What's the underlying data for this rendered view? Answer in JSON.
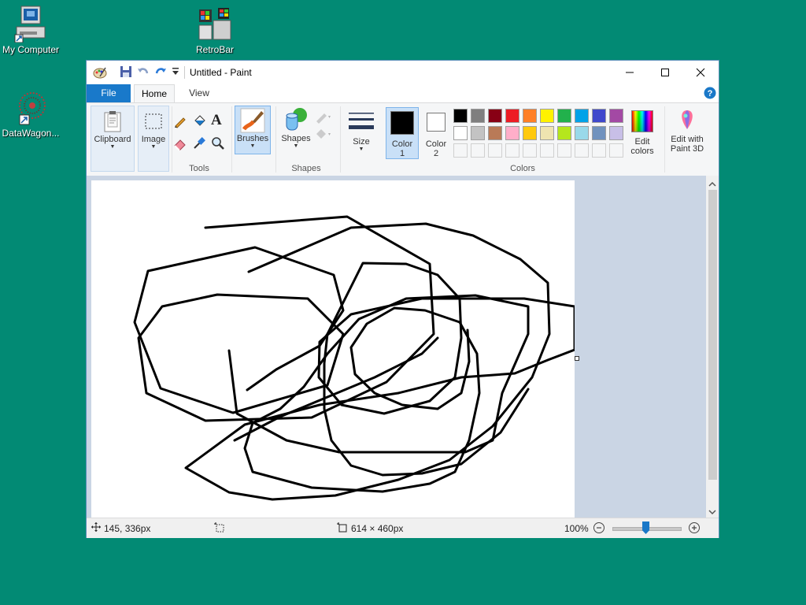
{
  "desktop": {
    "icons": [
      {
        "label": "My Computer",
        "icon": "computer-icon"
      },
      {
        "label": "RetroBar",
        "icon": "retrobar-icon"
      },
      {
        "label": "DataWagon...",
        "icon": "datawagon-icon"
      }
    ]
  },
  "window": {
    "title": "Untitled - Paint",
    "tabs": {
      "file": "File",
      "home": "Home",
      "view": "View"
    }
  },
  "ribbon": {
    "clipboard": {
      "label": "Clipboard"
    },
    "image": {
      "label": "Image"
    },
    "tools": {
      "group_label": "Tools"
    },
    "brushes": {
      "label": "Brushes"
    },
    "shapes": {
      "label": "Shapes",
      "group_label": "Shapes"
    },
    "size": {
      "label": "Size"
    },
    "color1": {
      "label": "Color",
      "num": "1",
      "value": "#000000"
    },
    "color2": {
      "label": "Color",
      "num": "2",
      "value": "#ffffff"
    },
    "colors": {
      "group_label": "Colors",
      "palette_row1": [
        "#000000",
        "#7f7f7f",
        "#880015",
        "#ed1c24",
        "#ff7f27",
        "#fff200",
        "#22b14c",
        "#00a2e8",
        "#3f48cc",
        "#a349a4"
      ],
      "palette_row2": [
        "#ffffff",
        "#c3c3c3",
        "#b97a57",
        "#ffaec9",
        "#ffc90e",
        "#efe4b0",
        "#b5e61d",
        "#99d9ea",
        "#7092be",
        "#c8bfe7"
      ]
    },
    "edit_colors": {
      "line1": "Edit",
      "line2": "colors"
    },
    "paint3d": {
      "line1": "Edit with",
      "line2": "Paint 3D"
    }
  },
  "status": {
    "cursor_pos": "145, 336px",
    "canvas_size": "614 × 460px",
    "zoom": "100%"
  }
}
